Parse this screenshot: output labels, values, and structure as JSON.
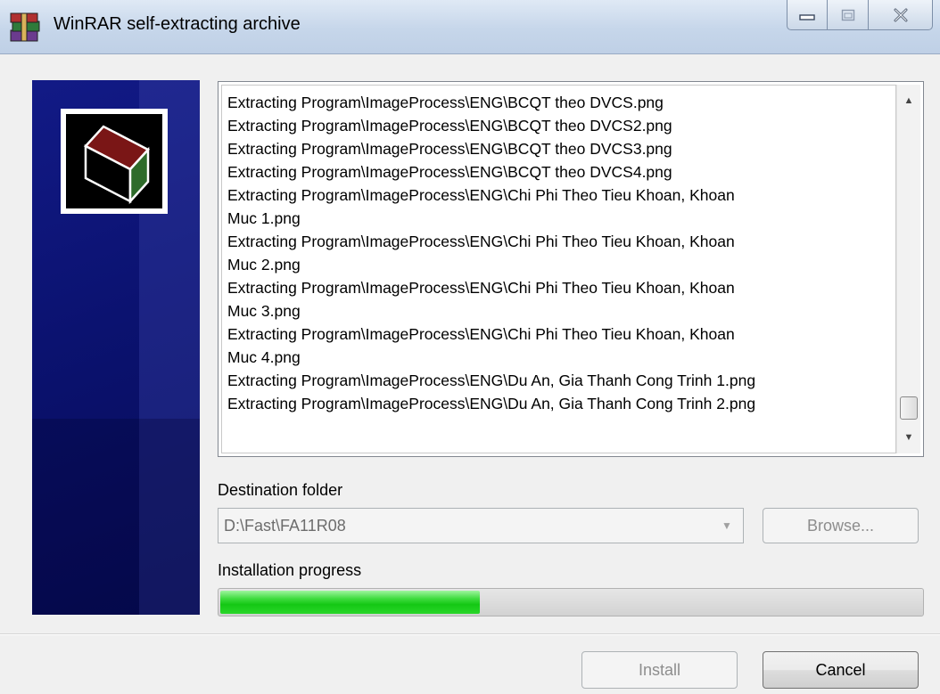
{
  "window": {
    "title": "WinRAR self-extracting archive",
    "icon": "winrar-books-icon"
  },
  "log": {
    "lines": [
      "Extracting Program\\ImageProcess\\ENG\\BCQT theo DVCS.png",
      "Extracting Program\\ImageProcess\\ENG\\BCQT theo DVCS2.png",
      "Extracting Program\\ImageProcess\\ENG\\BCQT theo DVCS3.png",
      "Extracting Program\\ImageProcess\\ENG\\BCQT theo DVCS4.png",
      "Extracting Program\\ImageProcess\\ENG\\Chi Phi Theo Tieu Khoan, Khoan\nMuc 1.png",
      "Extracting Program\\ImageProcess\\ENG\\Chi Phi Theo Tieu Khoan, Khoan\nMuc 2.png",
      "Extracting Program\\ImageProcess\\ENG\\Chi Phi Theo Tieu Khoan, Khoan\nMuc 3.png",
      "Extracting Program\\ImageProcess\\ENG\\Chi Phi Theo Tieu Khoan, Khoan\nMuc 4.png",
      "Extracting Program\\ImageProcess\\ENG\\Du An, Gia Thanh Cong Trinh 1.png",
      "Extracting Program\\ImageProcess\\ENG\\Du An, Gia Thanh Cong Trinh 2.png"
    ]
  },
  "destination": {
    "label": "Destination folder",
    "value": "D:\\Fast\\FA11R08",
    "browse_label": "Browse..."
  },
  "progress": {
    "label": "Installation progress",
    "fraction": 0.37
  },
  "buttons": {
    "install_label": "Install",
    "cancel_label": "Cancel"
  },
  "colors": {
    "banner": "#0b1270",
    "progress_fill": "#14c814"
  }
}
